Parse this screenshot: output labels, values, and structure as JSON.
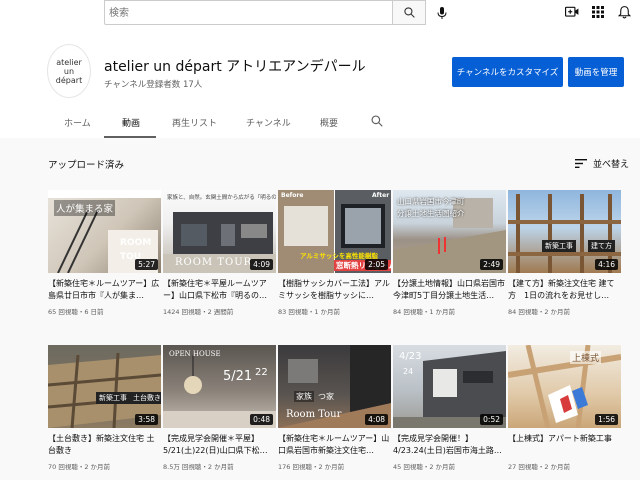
{
  "search": {
    "placeholder": "検索"
  },
  "channel": {
    "avatar_lines": [
      "atelier",
      "un",
      "départ"
    ],
    "name": "atelier un départ アトリエアンデパール",
    "subscribers": "チャンネル登録者数 17人",
    "customize_label": "チャンネルをカスタマイズ",
    "manage_label": "動画を管理"
  },
  "tabs": [
    {
      "label": "ホーム"
    },
    {
      "label": "動画"
    },
    {
      "label": "再生リスト"
    },
    {
      "label": "チャンネル"
    },
    {
      "label": "概要"
    }
  ],
  "section": {
    "title": "アップロード済み",
    "sort_label": "並べ替え"
  },
  "videos": [
    {
      "title": "【新築住宅＊ルームツアー】広島県廿日市市『人が集ま…",
      "meta": "65 回視聴・6 日前",
      "duration": "5:27",
      "overlay": [
        "人が集まる家",
        "ROOM",
        "TOU"
      ]
    },
    {
      "title": "【新築住宅＊平屋ルームツアー】山口県下松市『明るの…",
      "meta": "1424 回視聴・2 週間前",
      "duration": "4:09",
      "overlay": [
        "ROOM TOUR",
        "家族と、自然。玄関土間から広がる『明るの家』"
      ]
    },
    {
      "title": "【樹脂サッシカバー工法】アルミサッシを樹脂サッシに…",
      "meta": "83 回視聴・1 か月前",
      "duration": "2:05",
      "overlay": [
        "Before",
        "After",
        "アルミサッシを高性能樹脂",
        "窓断熱リフォーム"
      ]
    },
    {
      "title": "【分譲土地情報】山口県岩国市今津町5丁目分譲土地生活…",
      "meta": "84 回視聴・1 か月前",
      "duration": "2:49",
      "overlay": [
        "山口県岩国市今津町",
        "分譲土地生活圏紹介"
      ]
    },
    {
      "title": "【建て方】新築注文住宅 建て方　1日の流れをお見せし…",
      "meta": "84 回視聴・2 か月前",
      "duration": "4:16",
      "overlay": [
        "新築工事",
        "建て方"
      ]
    },
    {
      "title": "【土台敷き】新築注文住宅 土台敷き",
      "meta": "70 回視聴・2 か月前",
      "duration": "3:58",
      "overlay": [
        "新築工事",
        "土台敷き"
      ]
    },
    {
      "title": "【完成見学会開催＊平屋】5/21(土)22(日)山口県下松…",
      "meta": "8.5万 回視聴・2 か月前",
      "duration": "0:48",
      "overlay": [
        "OPEN HOUSE",
        "5/21",
        "22"
      ]
    },
    {
      "title": "【新築住宅＊ルームツアー】山口県岩国市新築注文住宅…",
      "meta": "176 回視聴・2 か月前",
      "duration": "4:08",
      "overlay": [
        "Room Tour",
        "家族",
        "つ家"
      ]
    },
    {
      "title": "【完成見学会開催！】4/23.24(土日)岩国市海土路…",
      "meta": "45 回視聴・2 か月前",
      "duration": "0:52",
      "overlay": [
        "4/23",
        "24"
      ]
    },
    {
      "title": "【上棟式】アパート新築工事",
      "meta": "27 回視聴・2 か月前",
      "duration": "1:56",
      "overlay": [
        "上棟式"
      ]
    }
  ],
  "colors": {
    "accent": "#065fd4",
    "background": "#f9f9f9"
  },
  "icons": [
    "search-icon",
    "mic-icon",
    "create-video-icon",
    "apps-grid-icon",
    "bell-icon",
    "sort-icon"
  ]
}
